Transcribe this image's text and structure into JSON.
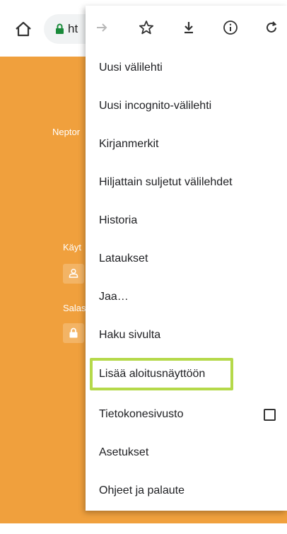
{
  "browser": {
    "url_text": "ht"
  },
  "page": {
    "neptor_text": "Neptor",
    "kayt_text": "Käyt",
    "sala_text": "Salas"
  },
  "menu": {
    "icons": [
      "forward-icon",
      "star-icon",
      "download-icon",
      "info-icon",
      "reload-icon"
    ],
    "items": [
      {
        "label": "Uusi välilehti"
      },
      {
        "label": "Uusi incognito-välilehti"
      },
      {
        "label": "Kirjanmerkit"
      },
      {
        "label": "Hiljattain suljetut välilehdet"
      },
      {
        "label": "Historia"
      },
      {
        "label": "Lataukset"
      },
      {
        "label": "Jaa…"
      },
      {
        "label": "Haku sivulta"
      },
      {
        "label": "Lisää aloitusnäyttöön"
      },
      {
        "label": "Tietokonesivusto"
      },
      {
        "label": "Asetukset"
      },
      {
        "label": "Ohjeet ja palaute"
      }
    ],
    "desktop_site_checked": false
  },
  "colors": {
    "page_bg": "#f0a03d",
    "highlight_border": "#b5d94a"
  }
}
